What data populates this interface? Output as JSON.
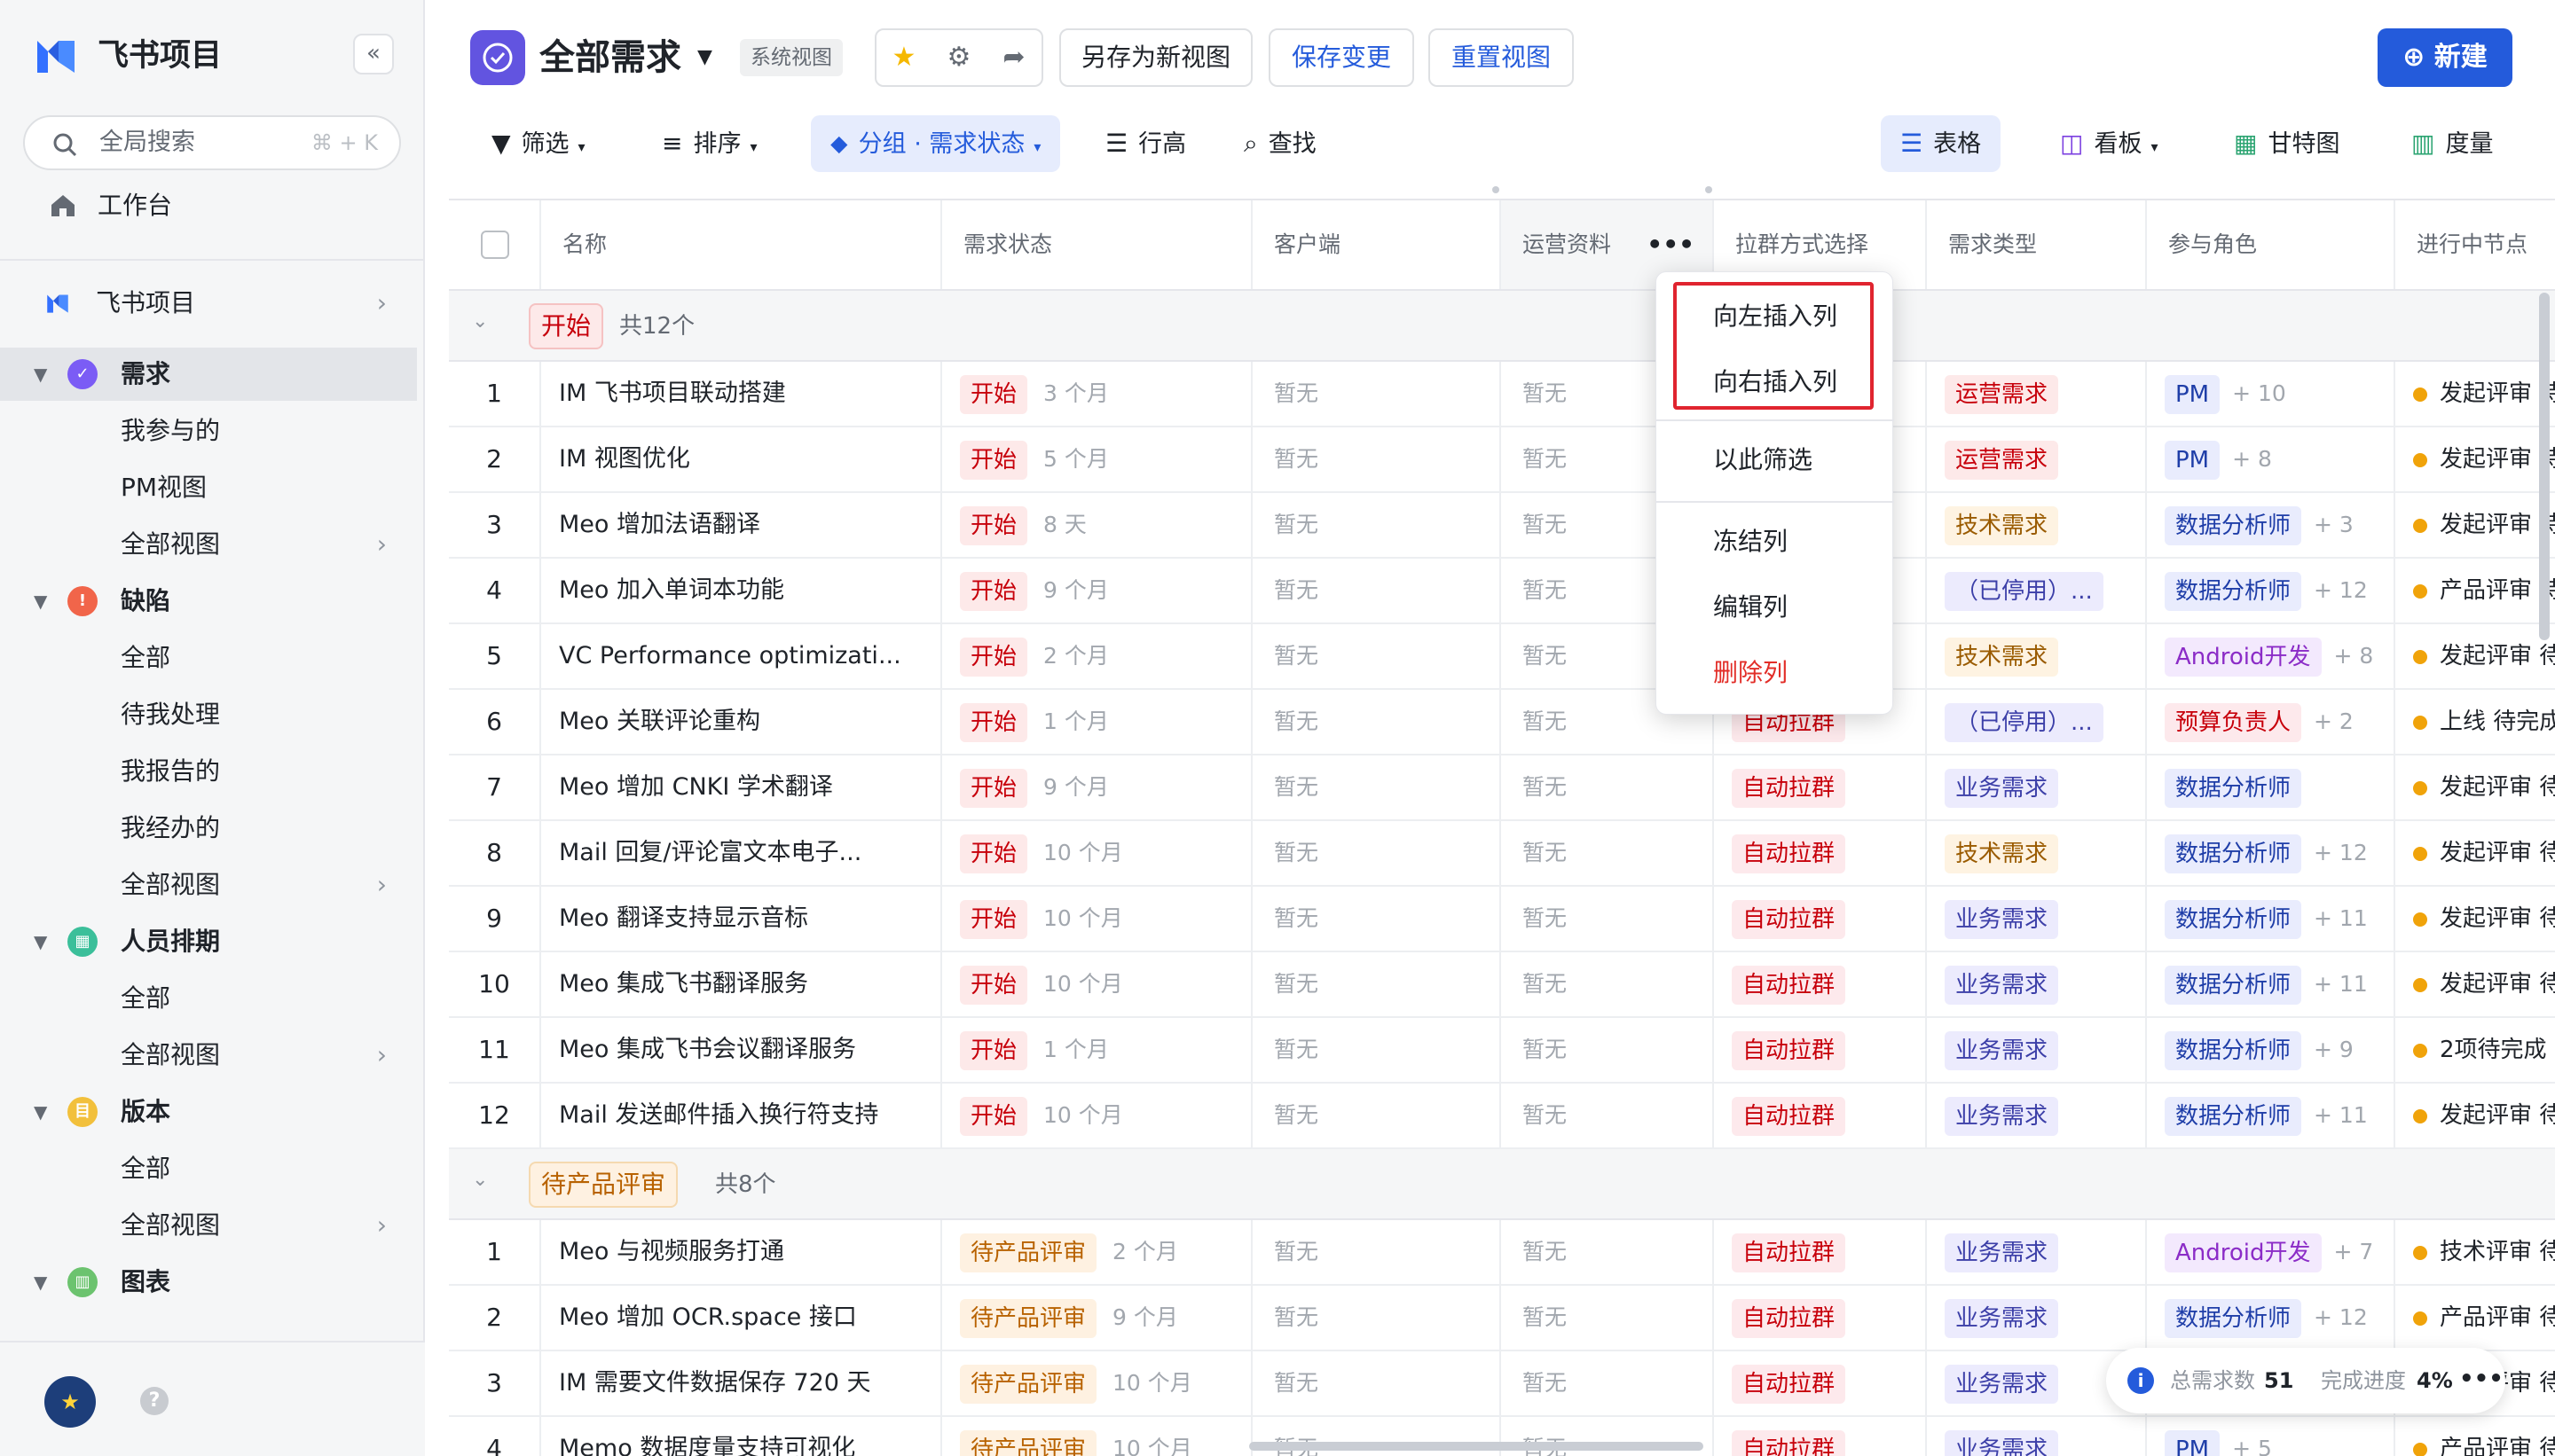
{
  "app": {
    "title": "飞书项目",
    "collapse_icon": "«"
  },
  "search": {
    "placeholder": "全局搜索",
    "shortcut": "⌘ + K"
  },
  "sidebar": {
    "workspace": "工作台",
    "project": "飞书项目",
    "sections": [
      {
        "label": "需求",
        "icon": "✓",
        "color": "#7b5cf5",
        "items": [
          "我参与的",
          "PM视图",
          "全部视图"
        ]
      },
      {
        "label": "缺陷",
        "icon": "!",
        "color": "#f1654a",
        "items": [
          "全部",
          "待我处理",
          "我报告的",
          "我经办的",
          "全部视图"
        ]
      },
      {
        "label": "人员排期",
        "icon": "▦",
        "color": "#3bbf9a",
        "items": [
          "全部",
          "全部视图"
        ]
      },
      {
        "label": "版本",
        "icon": "目",
        "color": "#f2c03c",
        "items": [
          "全部",
          "全部视图"
        ]
      },
      {
        "label": "图表",
        "icon": "▥",
        "color": "#6cc36f",
        "items": []
      }
    ]
  },
  "header": {
    "title": "全部需求",
    "tag": "系统视图",
    "save_as_new": "另存为新视图",
    "save_changes": "保存变更",
    "reset_view": "重置视图",
    "new": "新建"
  },
  "toolbar": {
    "filter": "筛选",
    "sort": "排序",
    "group": "分组 · 需求状态",
    "row_height": "行高",
    "find": "查找",
    "views": [
      "表格",
      "看板",
      "甘特图",
      "度量"
    ]
  },
  "columns": [
    "名称",
    "需求状态",
    "客户端",
    "运营资料",
    "拉群方式选择",
    "需求类型",
    "参与角色",
    "进行中节点"
  ],
  "empty": "暂无",
  "groups": [
    {
      "label": "开始",
      "count": "共12个",
      "rows": [
        {
          "no": "1",
          "name": "IM 飞书项目联动搭建",
          "status": "开始",
          "age": "3 个月",
          "grp": "",
          "type": "运营需求",
          "role": "PM",
          "more": "+ 10",
          "node": "发起评审 待"
        },
        {
          "no": "2",
          "name": "IM 视图优化",
          "status": "开始",
          "age": "5 个月",
          "grp": "",
          "type": "运营需求",
          "role": "PM",
          "more": "+ 8",
          "node": "发起评审 待"
        },
        {
          "no": "3",
          "name": "Meo 增加法语翻译",
          "status": "开始",
          "age": "8 天",
          "grp": "",
          "type": "技术需求",
          "role": "数据分析师",
          "more": "+ 3",
          "node": "发起评审 待"
        },
        {
          "no": "4",
          "name": "Meo 加入单词本功能",
          "status": "开始",
          "age": "9 个月",
          "grp": "",
          "type": "（已停用）...",
          "role": "数据分析师",
          "more": "+ 12",
          "node": "产品评审 待"
        },
        {
          "no": "5",
          "name": "VC Performance optimizati...",
          "status": "开始",
          "age": "2 个月",
          "grp": "",
          "type": "技术需求",
          "role": "Android开发",
          "more": "+ 8",
          "node": "发起评审 待"
        },
        {
          "no": "6",
          "name": "Meo 关联评论重构",
          "status": "开始",
          "age": "1 个月",
          "grp": "自动拉群",
          "type": "（已停用）...",
          "role": "预算负责人",
          "more": "+ 2",
          "node": "上线 待完成"
        },
        {
          "no": "7",
          "name": "Meo 增加 CNKI 学术翻译",
          "status": "开始",
          "age": "9 个月",
          "grp": "自动拉群",
          "type": "业务需求",
          "role": "数据分析师",
          "more": "",
          "node": "发起评审 待"
        },
        {
          "no": "8",
          "name": "Mail 回复/评论富文本电子...",
          "status": "开始",
          "age": "10 个月",
          "grp": "自动拉群",
          "type": "技术需求",
          "role": "数据分析师",
          "more": "+ 12",
          "node": "发起评审 待"
        },
        {
          "no": "9",
          "name": "Meo 翻译支持显示音标",
          "status": "开始",
          "age": "10 个月",
          "grp": "自动拉群",
          "type": "业务需求",
          "role": "数据分析师",
          "more": "+ 11",
          "node": "发起评审 待"
        },
        {
          "no": "10",
          "name": "Meo 集成飞书翻译服务",
          "status": "开始",
          "age": "10 个月",
          "grp": "自动拉群",
          "type": "业务需求",
          "role": "数据分析师",
          "more": "+ 11",
          "node": "发起评审 待"
        },
        {
          "no": "11",
          "name": "Meo 集成飞书会议翻译服务",
          "status": "开始",
          "age": "1 个月",
          "grp": "自动拉群",
          "type": "业务需求",
          "role": "数据分析师",
          "more": "+ 9",
          "node": "2项待完成"
        },
        {
          "no": "12",
          "name": "Mail 发送邮件插入换行符支持",
          "status": "开始",
          "age": "10 个月",
          "grp": "自动拉群",
          "type": "业务需求",
          "role": "数据分析师",
          "more": "+ 11",
          "node": "发起评审 待"
        }
      ]
    },
    {
      "label": "待产品评审",
      "count": "共8个",
      "rows": [
        {
          "no": "1",
          "name": "Meo 与视频服务打通",
          "status": "待产品评审",
          "age": "2 个月",
          "grp": "自动拉群",
          "type": "业务需求",
          "role": "Android开发",
          "more": "+ 7",
          "node": "技术评审 待"
        },
        {
          "no": "2",
          "name": "Meo 增加 OCR.space 接口",
          "status": "待产品评审",
          "age": "9 个月",
          "grp": "自动拉群",
          "type": "业务需求",
          "role": "数据分析师",
          "more": "+ 12",
          "node": "产品评审 待"
        },
        {
          "no": "3",
          "name": "IM 需要文件数据保存 720 天",
          "status": "待产品评审",
          "age": "10 个月",
          "grp": "自动拉群",
          "type": "业务需求",
          "role": "数据分析师",
          "more": "+ 11",
          "node": "发起评审 待"
        },
        {
          "no": "4",
          "name": "Memo 数据度量支持可视化",
          "status": "待产品评审",
          "age": "10 个月",
          "grp": "自动拉群",
          "type": "业务需求",
          "role": "PM",
          "more": "+ 5",
          "node": "产品评审 待"
        }
      ]
    }
  ],
  "context_menu": {
    "insert_left": "向左插入列",
    "insert_right": "向右插入列",
    "filter_by": "以此筛选",
    "freeze": "冻结列",
    "edit": "编辑列",
    "delete": "删除列"
  },
  "stats": {
    "total_label": "总需求数",
    "total": "51",
    "progress_label": "完成进度",
    "progress": "4%"
  }
}
